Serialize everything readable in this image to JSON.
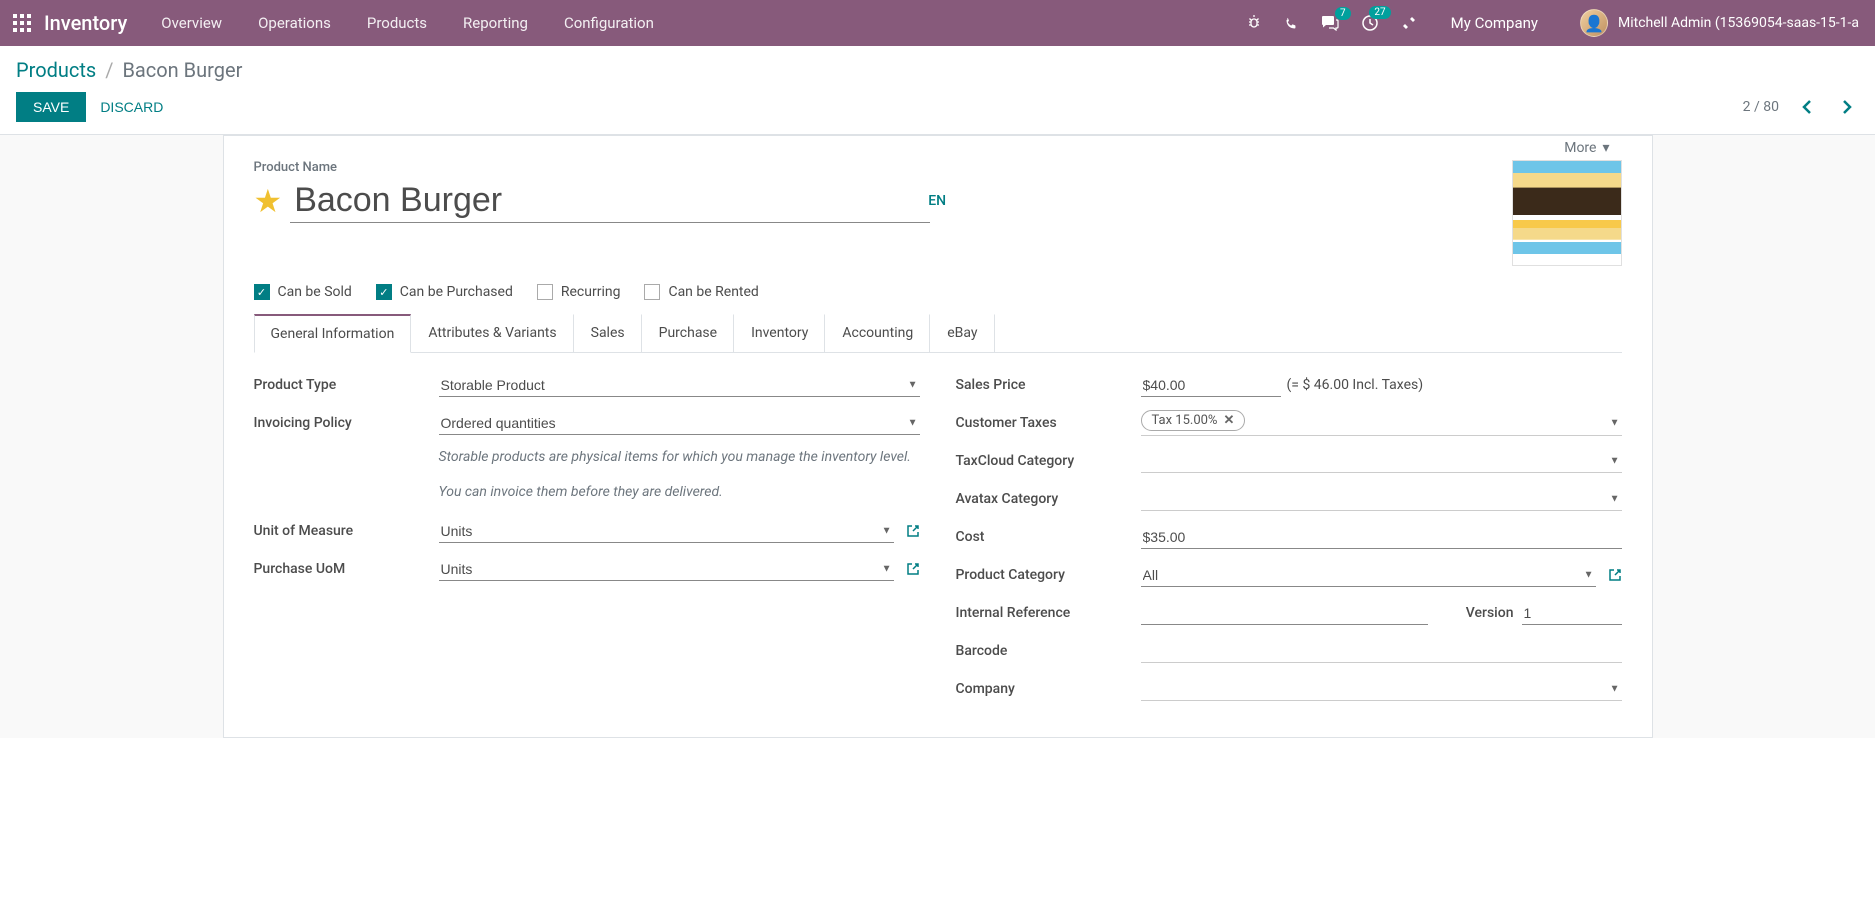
{
  "navbar": {
    "brand": "Inventory",
    "menu": [
      "Overview",
      "Operations",
      "Products",
      "Reporting",
      "Configuration"
    ],
    "messaging_badge": "7",
    "activities_badge": "27",
    "company": "My Company",
    "user": "Mitchell Admin (15369054-saas-15-1-a"
  },
  "breadcrumb": {
    "parent": "Products",
    "current": "Bacon Burger"
  },
  "buttons": {
    "save": "SAVE",
    "discard": "DISCARD"
  },
  "pager": {
    "text": "2 / 80"
  },
  "more_label": "More",
  "product": {
    "name_label": "Product Name",
    "name": "Bacon Burger",
    "lang": "EN"
  },
  "options": {
    "can_be_sold": "Can be Sold",
    "can_be_purchased": "Can be Purchased",
    "recurring": "Recurring",
    "can_be_rented": "Can be Rented"
  },
  "tabs": [
    "General Information",
    "Attributes & Variants",
    "Sales",
    "Purchase",
    "Inventory",
    "Accounting",
    "eBay"
  ],
  "left_fields": {
    "product_type": {
      "label": "Product Type",
      "value": "Storable Product"
    },
    "invoicing_policy": {
      "label": "Invoicing Policy",
      "value": "Ordered quantities"
    },
    "help1": "Storable products are physical items for which you manage the inventory level.",
    "help2": "You can invoice them before they are delivered.",
    "uom": {
      "label": "Unit of Measure",
      "value": "Units"
    },
    "purchase_uom": {
      "label": "Purchase UoM",
      "value": "Units"
    }
  },
  "right_fields": {
    "sales_price": {
      "label": "Sales Price",
      "value": "$40.00",
      "incl": "(= $ 46.00 Incl. Taxes)"
    },
    "customer_taxes": {
      "label": "Customer Taxes",
      "tag": "Tax 15.00%"
    },
    "taxcloud": {
      "label": "TaxCloud Category"
    },
    "avatax": {
      "label": "Avatax Category"
    },
    "cost": {
      "label": "Cost",
      "value": "$35.00"
    },
    "product_category": {
      "label": "Product Category",
      "value": "All"
    },
    "internal_ref": {
      "label": "Internal Reference"
    },
    "version": {
      "label": "Version",
      "value": "1"
    },
    "barcode": {
      "label": "Barcode"
    },
    "company": {
      "label": "Company"
    }
  }
}
